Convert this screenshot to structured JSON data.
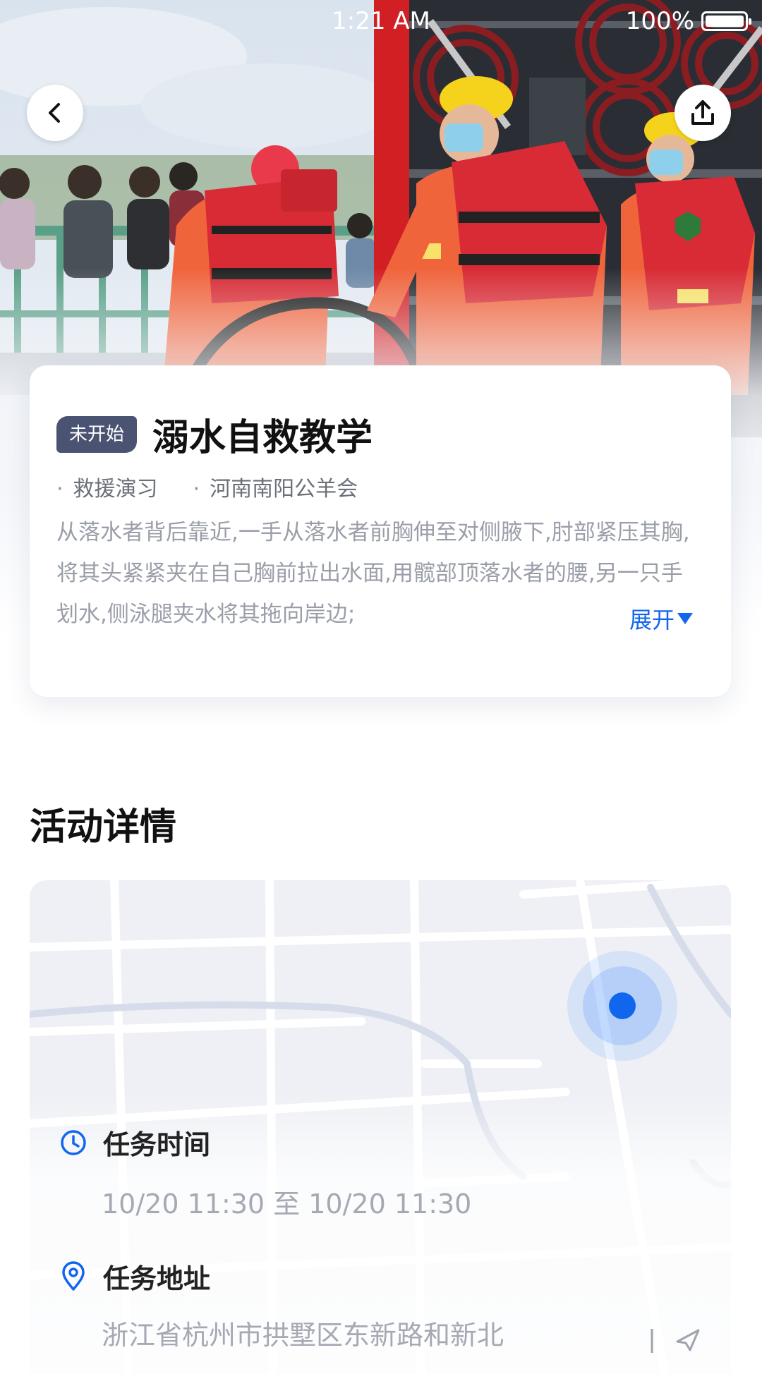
{
  "status_bar": {
    "time": "1:21 AM",
    "battery": "100%"
  },
  "activity": {
    "status": "未开始",
    "title": "溺水自救教学",
    "category": "救援演习",
    "organizer": "河南南阳公羊会",
    "description": "从落水者背后靠近,一手从落水者前胸伸至对侧腋下,肘部紧压其胸,将其头紧紧夹在自己胸前拉出水面,用髋部顶落水者的腰,另一只手划水,侧泳腿夹水将其拖向岸边;",
    "expand_label": "展开"
  },
  "details": {
    "section_title": "活动详情",
    "time_label": "任务时间",
    "time_value": "10/20 11:30 至 10/20 11:30",
    "address_label": "任务地址",
    "address_value": "浙江省杭州市拱墅区东新路和新北"
  },
  "colors": {
    "accent": "#1166ee",
    "badge": "#4a5472",
    "uniform": "#f0643c"
  },
  "icons": [
    "back-arrow-icon",
    "share-icon",
    "clock-icon",
    "location-pin-icon",
    "map-marker-icon"
  ]
}
